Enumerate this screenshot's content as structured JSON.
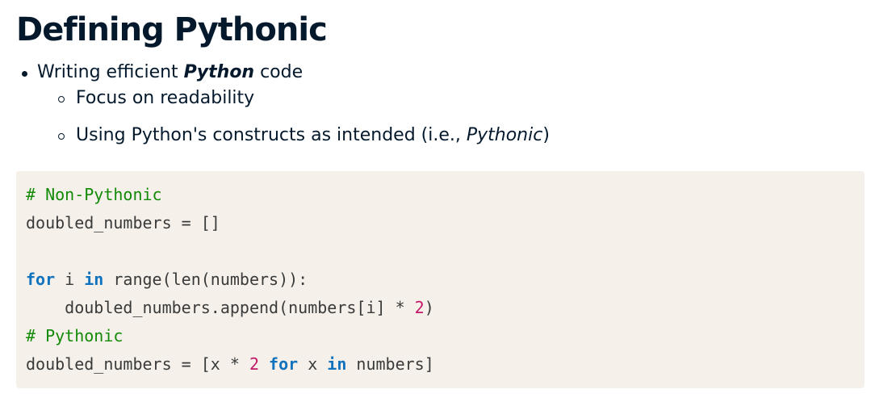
{
  "slide": {
    "title": "Defining Pythonic"
  },
  "bullets": {
    "main": {
      "prefix": "Writing efficient ",
      "emphasis": "Python",
      "suffix": " code"
    },
    "sub": [
      {
        "text": "Focus on readability"
      },
      {
        "prefix": "Using Python's constructs as intended (i.e., ",
        "emphasis": "Pythonic",
        "suffix": ")"
      }
    ]
  },
  "code": {
    "background": "#f5f1ea",
    "colors": {
      "comment": "#138a07",
      "keyword": "#1172bd",
      "number": "#c21867",
      "default": "#3a3a3a"
    },
    "lines": [
      {
        "comment": "# Non-Pythonic"
      },
      {
        "text": "doubled_numbers = []"
      },
      {
        "blank": ""
      },
      {
        "kw1": "for",
        "t1": " i ",
        "kw2": "in",
        "t2": " range(len(numbers)):"
      },
      {
        "indent": "    ",
        "text": "doubled_numbers.append(numbers[i] * ",
        "num": "2",
        "close": ")"
      },
      {
        "comment": "# Pythonic"
      },
      {
        "t1": "doubled_numbers = [x * ",
        "num": "2",
        "t2": " ",
        "kw1": "for",
        "t3": " x ",
        "kw2": "in",
        "t4": " numbers]"
      }
    ]
  }
}
